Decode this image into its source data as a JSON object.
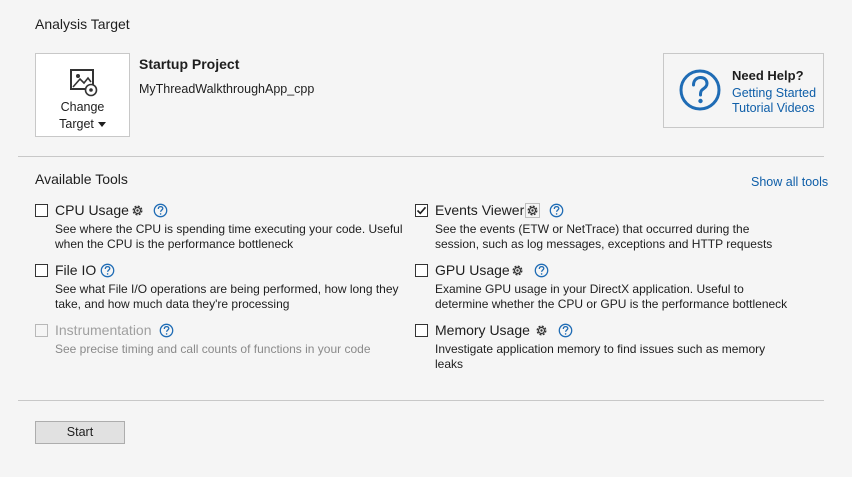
{
  "analysis_target": {
    "heading": "Analysis Target",
    "change_target": {
      "line1": "Change",
      "line2": "Target"
    },
    "startup_project_title": "Startup Project",
    "startup_project_name": "MyThreadWalkthroughApp_cpp"
  },
  "help": {
    "title": "Need Help?",
    "links": [
      "Getting Started",
      "Tutorial Videos"
    ]
  },
  "available_tools": {
    "heading": "Available Tools",
    "show_all": "Show all tools",
    "left": [
      {
        "name": "CPU Usage",
        "checked": false,
        "disabled": false,
        "desc": "See where the CPU is spending time executing your code. Useful when the CPU is the performance bottleneck"
      },
      {
        "name": "File IO",
        "checked": false,
        "disabled": false,
        "desc": "See what File I/O operations are being performed, how long they take, and how much data they're processing"
      },
      {
        "name": "Instrumentation",
        "checked": false,
        "disabled": true,
        "desc": "See precise timing and call counts of functions in your code"
      }
    ],
    "right": [
      {
        "name": "Events Viewer",
        "checked": true,
        "disabled": false,
        "desc": "See the events (ETW or NetTrace) that occurred during the session, such as log messages, exceptions and HTTP requests"
      },
      {
        "name": "GPU Usage",
        "checked": false,
        "disabled": false,
        "desc": "Examine GPU usage in your DirectX application. Useful to determine whether the CPU or GPU is the performance bottleneck"
      },
      {
        "name": "Memory Usage",
        "checked": false,
        "disabled": false,
        "desc": "Investigate application memory to find issues such as memory leaks"
      }
    ]
  },
  "start_button": "Start",
  "colors": {
    "link": "#0e5ea8",
    "help_icon": "#1f6cb5",
    "background": "#f5f5f5"
  }
}
